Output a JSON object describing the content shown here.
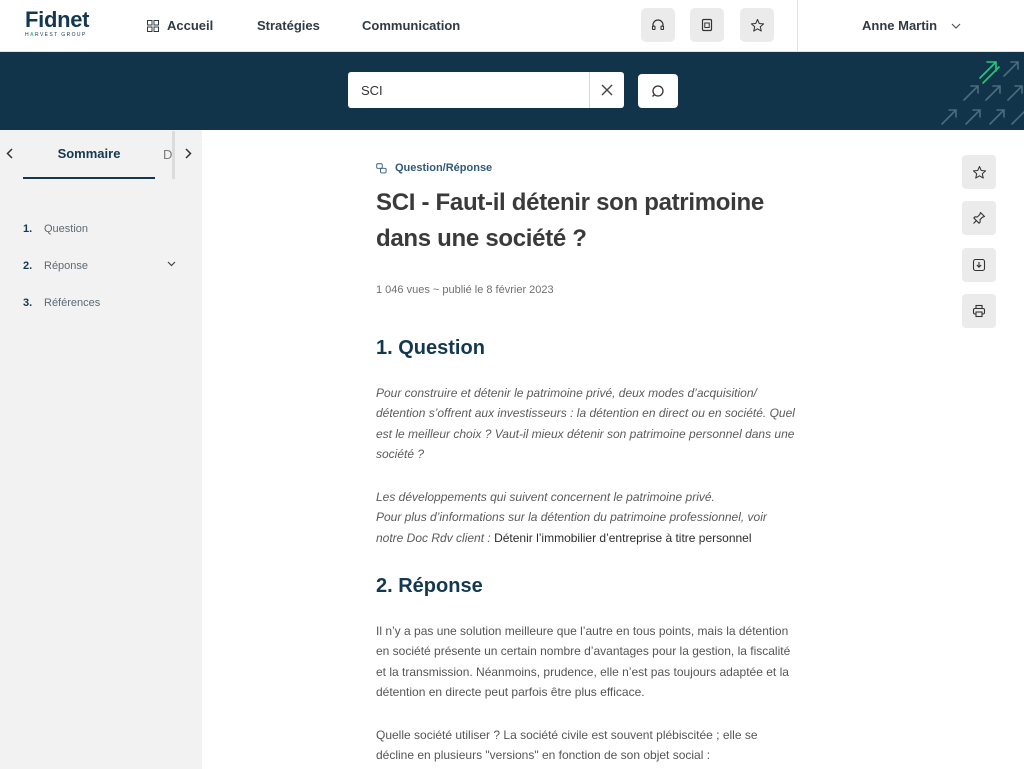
{
  "header": {
    "logo": "Fidnet",
    "logo_sub_a": "H",
    "logo_sub_b": "A",
    "logo_sub_c": "RVEST GROUP",
    "nav": {
      "home": "Accueil",
      "strategies": "Stratégies",
      "communication": "Communication"
    },
    "icons": [
      "headset-icon",
      "document-icon",
      "star-icon"
    ],
    "user_name": "Anne Martin"
  },
  "search": {
    "value": "SCI",
    "placeholder": ""
  },
  "sidebar": {
    "tab_active": "Sommaire",
    "tab_next": "Documents",
    "toc": [
      {
        "num": "1.",
        "label": "Question"
      },
      {
        "num": "2.",
        "label": "Réponse"
      },
      {
        "num": "3.",
        "label": "Références"
      }
    ]
  },
  "article": {
    "kicker": "Question/Réponse",
    "title": "SCI - Faut-il détenir son patrimoine dans une société ?",
    "meta": "1 046 vues ~ publié le 8 février 2023",
    "section1_title": "1. Question",
    "q_para1": "Pour construire et détenir le patrimoine privé, deux modes d’acquisition/ détention s’offrent aux investisseurs : la détention en direct ou en société. Quel est le meilleur choix ? Vaut-il mieux détenir son patrimoine personnel dans une société ?",
    "q_para2_line1": "Les développements qui suivent concernent le patrimoine privé.",
    "q_para2_line2": "Pour plus d’informations sur la détention du patrimoine professionnel, voir notre Doc Rdv client : ",
    "q_link": "Détenir l’immobilier d’entreprise à titre personnel",
    "section2_title": "2. Réponse",
    "r_para1": "Il n’y a pas une solution meilleure que l’autre en tous points, mais la détention en société présente un certain nombre d’avantages pour la gestion, la fiscalité et la transmission. Néanmoins, prudence, elle n’est pas toujours adaptée et la détention en directe peut parfois être plus efficace.",
    "r_para2": "Quelle société utiliser ? La société civile est souvent plébiscitée ; elle se décline en plusieurs \"versions\" en fonction de son objet social :"
  },
  "tools": [
    "star-icon",
    "pin-icon",
    "download-icon",
    "print-icon"
  ],
  "colors": {
    "brand": "#14394f",
    "band": "#12344b",
    "accent": "#2bc47c"
  }
}
